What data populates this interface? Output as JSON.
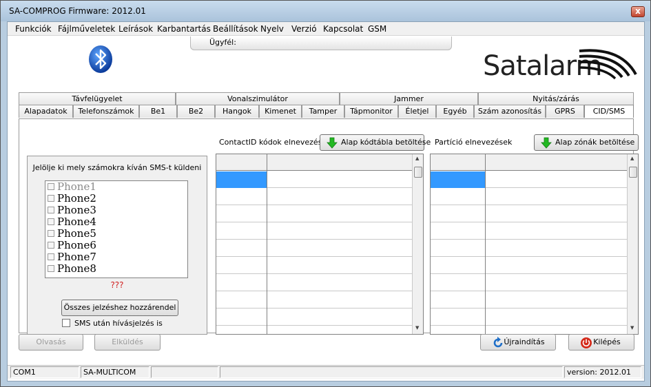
{
  "window": {
    "title": "SA-COMPROG Firmware: 2012.01",
    "close_label": "x"
  },
  "menu": [
    "Funkciók",
    "Fájlműveletek",
    "Leírások",
    "Karbantartás",
    "Beállítások",
    "Nyelv",
    "Verzió",
    "Kapcsolat",
    "GSM"
  ],
  "client_bar": {
    "label": "Ügyfél:"
  },
  "logo": {
    "brand": "Satalarm"
  },
  "tabs_top": [
    "Távfelügyelet",
    "Vonalszimulátor",
    "Jammer",
    "Nyitás/zárás"
  ],
  "tabs_bottom": [
    "Alapadatok",
    "Telefonszámok",
    "Be1",
    "Be2",
    "Hangok",
    "Kimenet",
    "Tamper",
    "Tápmonitor",
    "Életjel",
    "Egyéb",
    "Szám azonosítás",
    "GPRS",
    "CID/SMS"
  ],
  "active_tab": "CID/SMS",
  "sms_group": {
    "label": "Jelölje ki mely számokra kíván SMS-t küldeni",
    "phones": [
      "Phone1",
      "Phone2",
      "Phone3",
      "Phone4",
      "Phone5",
      "Phone6",
      "Phone7",
      "Phone8"
    ],
    "status": "???",
    "assign_button": "Összes jelzéshez hozzárendel",
    "sms_call_checkbox": "SMS után hívásjelzés is"
  },
  "contactid": {
    "title": "ContactID kódok elnevezései",
    "load_button": "Alap kódtábla betöltése"
  },
  "partition": {
    "title": "Partíció elnevezések",
    "load_button": "Alap zónák betöltése"
  },
  "buttons": {
    "read": "Olvasás",
    "send": "Elküldés",
    "restart": "Újraindítás",
    "exit": "Kilépés"
  },
  "status_bar": {
    "port": "COM1",
    "device": "SA-MULTICOM",
    "cell3": "",
    "cell4": "",
    "version": "version: 2012.01"
  },
  "colors": {
    "selection": "#3399ff",
    "warning": "#d02020",
    "arrow_green": "#22b822",
    "restart_blue": "#1f6fc8",
    "exit_red": "#d42a1a"
  }
}
